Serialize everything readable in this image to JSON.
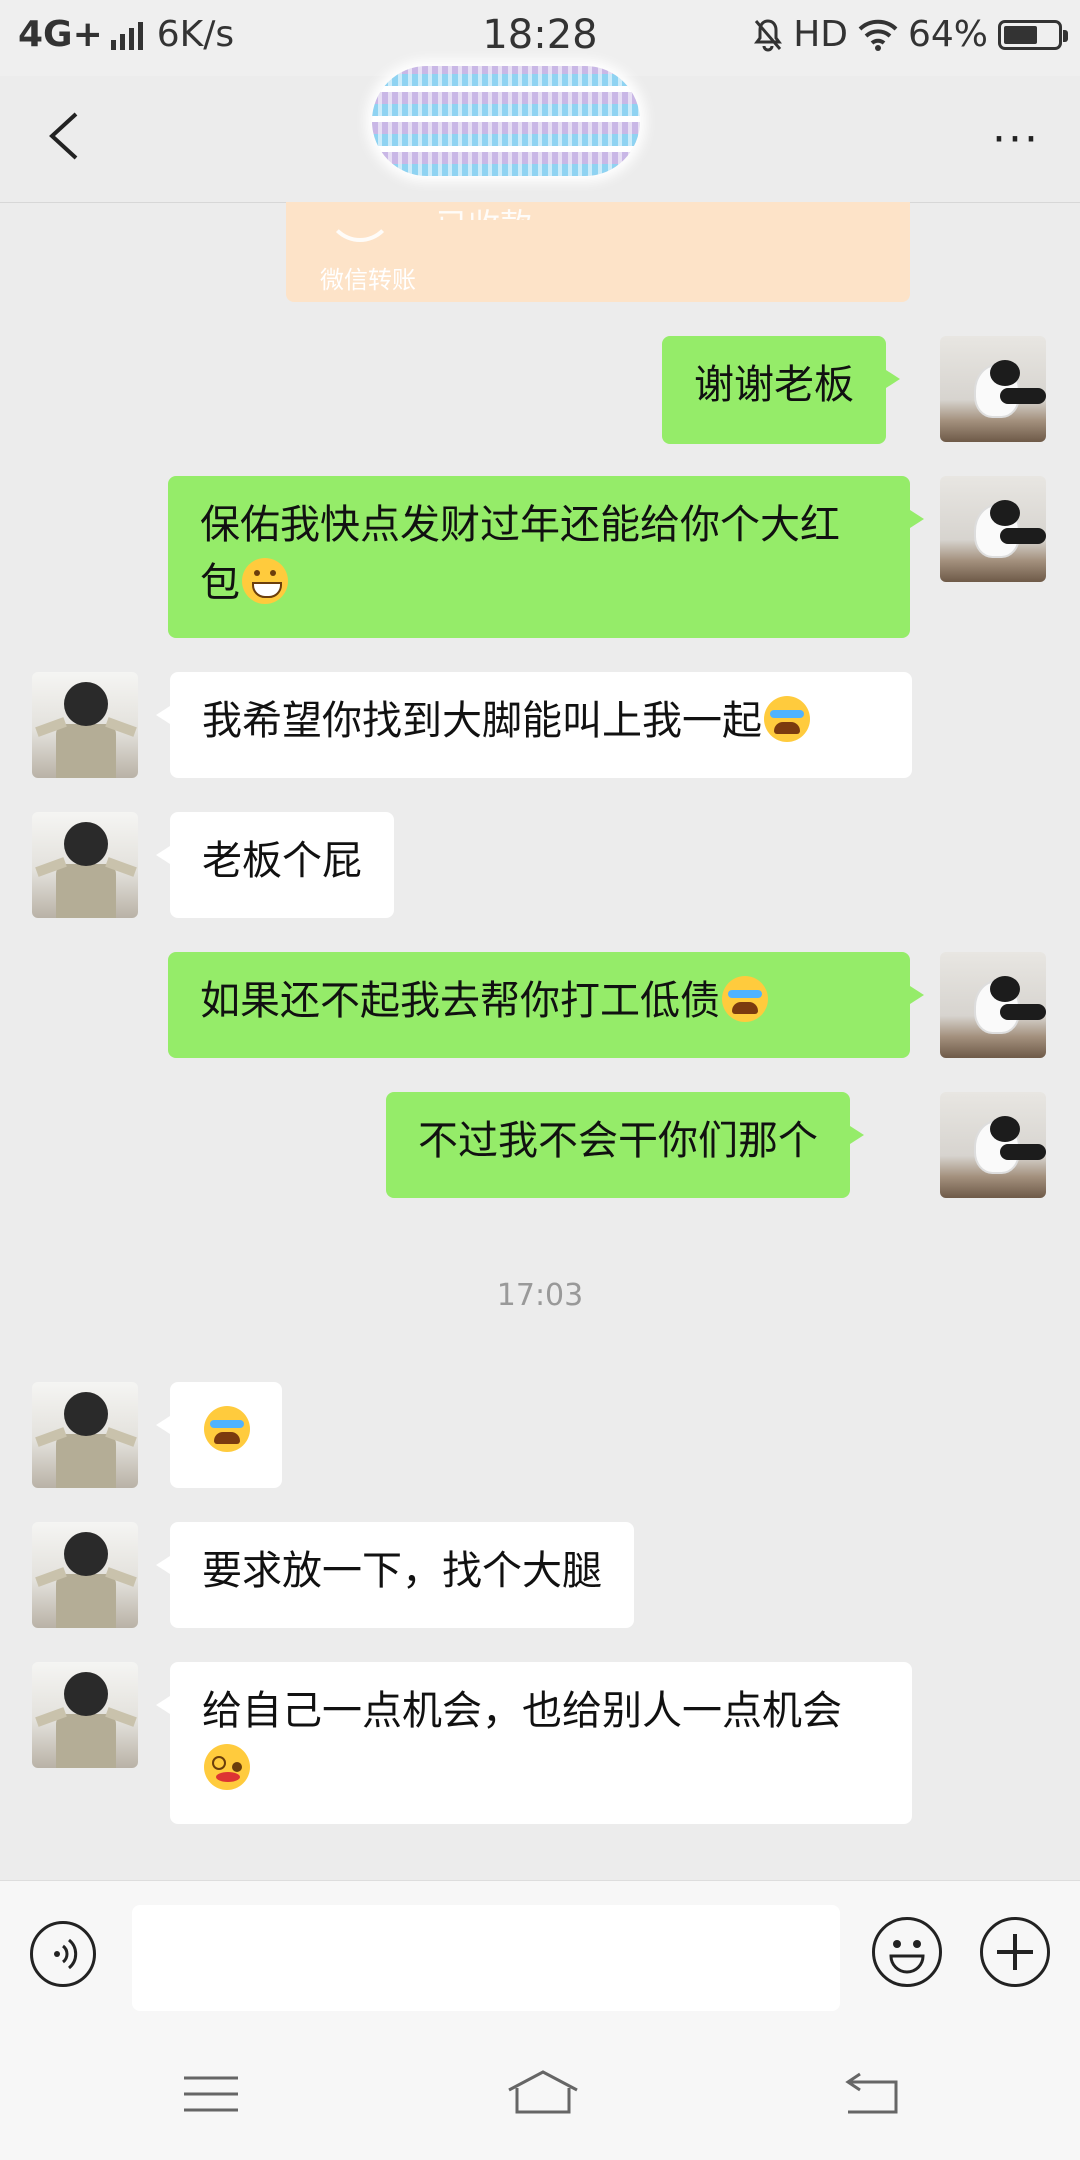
{
  "status_bar": {
    "network": "4G+",
    "speed": "6K/s",
    "time": "18:28",
    "hd": "HD",
    "battery": "64%",
    "battery_level": 0.64
  },
  "header": {
    "back_icon": "chevron-left-icon",
    "more_label": "···"
  },
  "transfer_card": {
    "partial_status": "已收款",
    "label": "微信转账"
  },
  "messages": [
    {
      "side": "out",
      "text": "谢谢老板",
      "emoji": ""
    },
    {
      "side": "out",
      "text": "保佑我快点发财过年还能给你个大红包",
      "emoji": "grinning-face"
    },
    {
      "side": "in",
      "text": "我希望你找到大脚能叫上我一起",
      "emoji": "face-with-tears"
    },
    {
      "side": "in",
      "text": "老板个屁",
      "emoji": ""
    },
    {
      "side": "out",
      "text": "如果还不起我去帮你打工低债",
      "emoji": "face-with-tears"
    },
    {
      "side": "out",
      "text": "不过我不会干你们那个",
      "emoji": ""
    },
    {
      "side": "in",
      "text": "",
      "emoji": "face-with-tears"
    },
    {
      "side": "in",
      "text": "要求放一下，找个大腿",
      "emoji": ""
    },
    {
      "side": "in",
      "text": "给自己一点机会，也给别人一点机会",
      "emoji": "woozy-face"
    }
  ],
  "timestamp": "17:03",
  "input_bar": {
    "voice_icon": "voice-icon",
    "input_value": "",
    "emoji_icon": "smiley-icon",
    "plus_icon": "plus-icon"
  },
  "system_nav": {
    "menu_icon": "menu-icon",
    "home_icon": "home-icon",
    "back_icon": "return-icon"
  }
}
